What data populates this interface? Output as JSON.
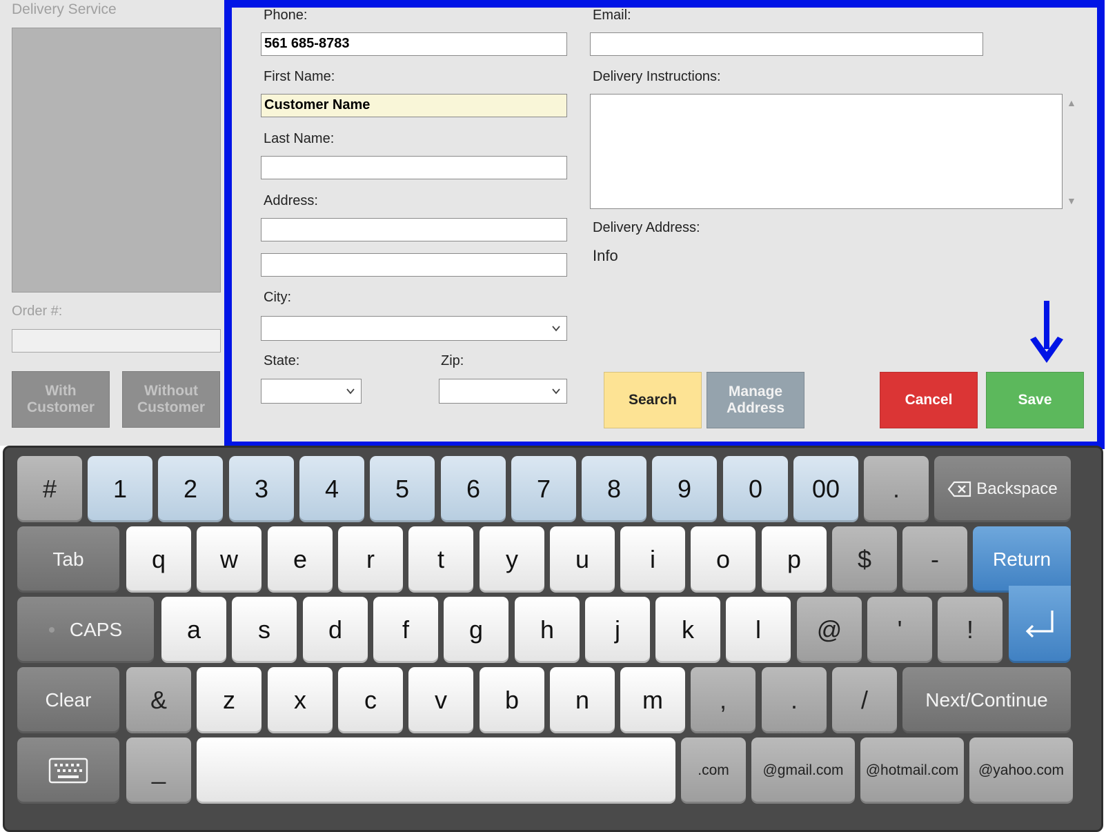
{
  "left_panel": {
    "title": "Delivery Service",
    "order_label": "Order #:",
    "with_customer": "With Customer",
    "without_customer": "Without Customer"
  },
  "form": {
    "phone_label": "Phone:",
    "phone_value": "561 685-8783",
    "email_label": "Email:",
    "email_value": "",
    "first_name_label": "First Name:",
    "first_name_value": "Customer Name",
    "last_name_label": "Last Name:",
    "last_name_value": "",
    "address_label": "Address:",
    "address1_value": "",
    "address2_value": "",
    "city_label": "City:",
    "state_label": "State:",
    "zip_label": "Zip:",
    "delivery_instructions_label": "Delivery Instructions:",
    "delivery_address_label": "Delivery Address:",
    "delivery_address_value": "Info"
  },
  "actions": {
    "search": "Search",
    "manage_address": "Manage Address",
    "cancel": "Cancel",
    "save": "Save"
  },
  "colors": {
    "highlight_frame": "#0014e6",
    "search": "#fde394",
    "manage": "#95a3ad",
    "cancel": "#db3535",
    "save": "#5cb85c",
    "return_key": "#4a8ccc"
  },
  "keyboard": {
    "row1": [
      "#",
      "1",
      "2",
      "3",
      "4",
      "5",
      "6",
      "7",
      "8",
      "9",
      "0",
      "00",
      "."
    ],
    "backspace": "Backspace",
    "tab": "Tab",
    "row2": [
      "q",
      "w",
      "e",
      "r",
      "t",
      "y",
      "u",
      "i",
      "o",
      "p",
      "$",
      "-"
    ],
    "return": "Return",
    "caps": "CAPS",
    "row3": [
      "a",
      "s",
      "d",
      "f",
      "g",
      "h",
      "j",
      "k",
      "l",
      "@",
      "'",
      "!"
    ],
    "clear": "Clear",
    "row4": [
      "&",
      "z",
      "x",
      "c",
      "v",
      "b",
      "n",
      "m",
      ",",
      ".",
      "/"
    ],
    "next": "Next/Continue",
    "underscore": "_",
    "row5": [
      ".com",
      "@gmail.com",
      "@hotmail.com",
      "@yahoo.com"
    ]
  }
}
